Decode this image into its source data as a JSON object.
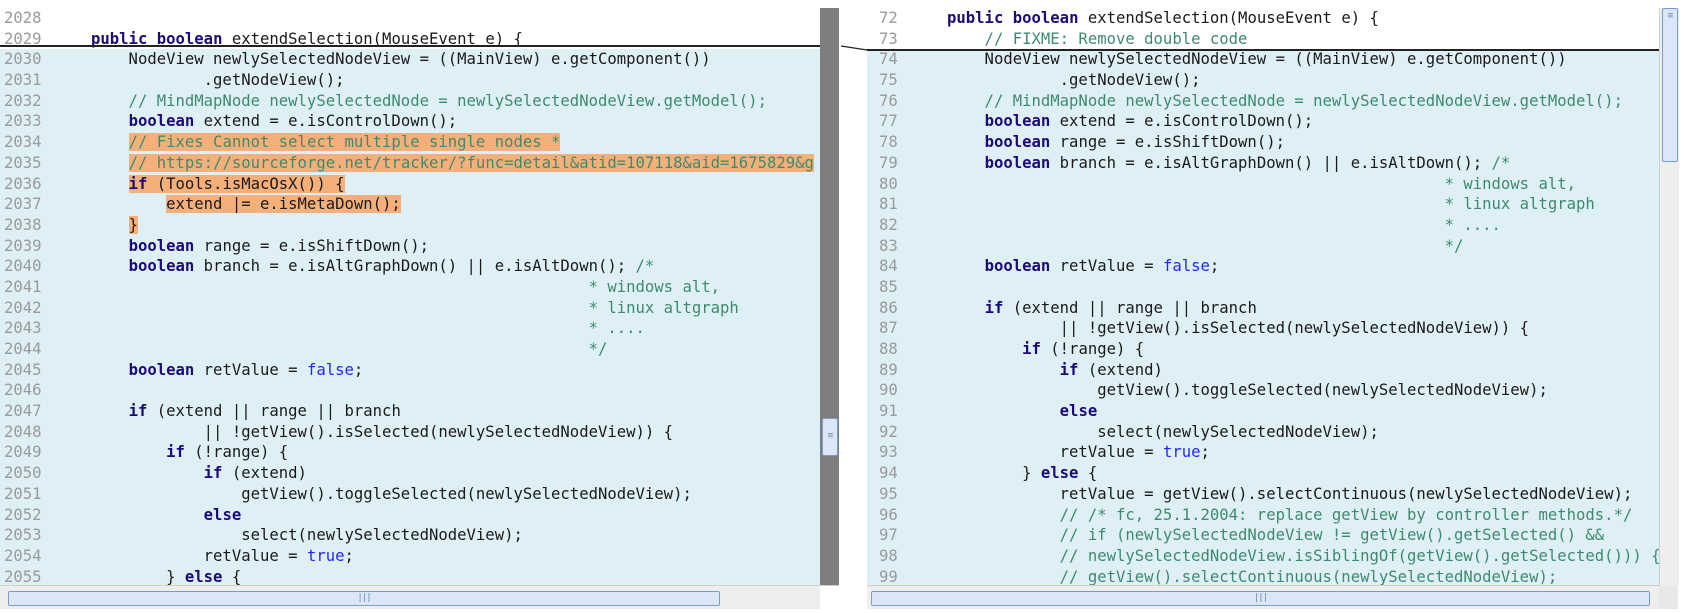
{
  "left": {
    "lines": [
      {
        "n": "2028",
        "code": ""
      },
      {
        "n": "2029",
        "code": "public boolean extendSelection(MouseEvent e) {"
      },
      {
        "n": "2030",
        "code": "    NodeView newlySelectedNodeView = ((MainView) e.getComponent())"
      },
      {
        "n": "2031",
        "code": "            .getNodeView();"
      },
      {
        "n": "2032",
        "code": "    // MindMapNode newlySelectedNode = newlySelectedNodeView.getModel();"
      },
      {
        "n": "2033",
        "code": "    boolean extend = e.isControlDown();"
      },
      {
        "n": "2034",
        "code": "    // Fixes Cannot select multiple single nodes *"
      },
      {
        "n": "2035",
        "code": "    // https://sourceforge.net/tracker/?func=detail&atid=107118&aid=1675829&g"
      },
      {
        "n": "2036",
        "code": "    if (Tools.isMacOsX()) {"
      },
      {
        "n": "2037",
        "code": "        extend |= e.isMetaDown();"
      },
      {
        "n": "2038",
        "code": "    }"
      },
      {
        "n": "2039",
        "code": "    boolean range = e.isShiftDown();"
      },
      {
        "n": "2040",
        "code": "    boolean branch = e.isAltGraphDown() || e.isAltDown(); /*"
      },
      {
        "n": "2041",
        "code": "                                                     * windows alt,"
      },
      {
        "n": "2042",
        "code": "                                                     * linux altgraph"
      },
      {
        "n": "2043",
        "code": "                                                     * ...."
      },
      {
        "n": "2044",
        "code": "                                                     */"
      },
      {
        "n": "2045",
        "code": "    boolean retValue = false;"
      },
      {
        "n": "2046",
        "code": ""
      },
      {
        "n": "2047",
        "code": "    if (extend || range || branch"
      },
      {
        "n": "2048",
        "code": "            || !getView().isSelected(newlySelectedNodeView)) {"
      },
      {
        "n": "2049",
        "code": "        if (!range) {"
      },
      {
        "n": "2050",
        "code": "            if (extend)"
      },
      {
        "n": "2051",
        "code": "                getView().toggleSelected(newlySelectedNodeView);"
      },
      {
        "n": "2052",
        "code": "            else"
      },
      {
        "n": "2053",
        "code": "                select(newlySelectedNodeView);"
      },
      {
        "n": "2054",
        "code": "            retValue = true;"
      },
      {
        "n": "2055",
        "code": "        } else {"
      }
    ]
  },
  "right": {
    "lines": [
      {
        "n": "72",
        "code": "public boolean extendSelection(MouseEvent e) {"
      },
      {
        "n": "73",
        "code": "    // FIXME: Remove double code"
      },
      {
        "n": "74",
        "code": "    NodeView newlySelectedNodeView = ((MainView) e.getComponent())"
      },
      {
        "n": "75",
        "code": "            .getNodeView();"
      },
      {
        "n": "76",
        "code": "    // MindMapNode newlySelectedNode = newlySelectedNodeView.getModel();"
      },
      {
        "n": "77",
        "code": "    boolean extend = e.isControlDown();"
      },
      {
        "n": "78",
        "code": "    boolean range = e.isShiftDown();"
      },
      {
        "n": "79",
        "code": "    boolean branch = e.isAltGraphDown() || e.isAltDown(); /*"
      },
      {
        "n": "80",
        "code": "                                                     * windows alt,"
      },
      {
        "n": "81",
        "code": "                                                     * linux altgraph"
      },
      {
        "n": "82",
        "code": "                                                     * ...."
      },
      {
        "n": "83",
        "code": "                                                     */"
      },
      {
        "n": "84",
        "code": "    boolean retValue = false;"
      },
      {
        "n": "85",
        "code": ""
      },
      {
        "n": "86",
        "code": "    if (extend || range || branch"
      },
      {
        "n": "87",
        "code": "            || !getView().isSelected(newlySelectedNodeView)) {"
      },
      {
        "n": "88",
        "code": "        if (!range) {"
      },
      {
        "n": "89",
        "code": "            if (extend)"
      },
      {
        "n": "90",
        "code": "                getView().toggleSelected(newlySelectedNodeView);"
      },
      {
        "n": "91",
        "code": "            else"
      },
      {
        "n": "92",
        "code": "                select(newlySelectedNodeView);"
      },
      {
        "n": "93",
        "code": "            retValue = true;"
      },
      {
        "n": "94",
        "code": "        } else {"
      },
      {
        "n": "95",
        "code": "            retValue = getView().selectContinuous(newlySelectedNodeView);"
      },
      {
        "n": "96",
        "code": "            // /* fc, 25.1.2004: replace getView by controller methods.*/"
      },
      {
        "n": "97",
        "code": "            // if (newlySelectedNodeView != getView().getSelected() &&"
      },
      {
        "n": "98",
        "code": "            // newlySelectedNodeView.isSiblingOf(getView().getSelected())) {"
      },
      {
        "n": "99",
        "code": "            // getView().selectContinuous(newlySelectedNodeView);"
      }
    ]
  },
  "scrollbars": {
    "vertical_grip_icon": "grip-lines",
    "horizontal_grip_icon": "grip-lines"
  },
  "colors": {
    "changed_block_bg": "#def0f6",
    "inline_change_highlight": "#f5b07a",
    "keyword": "#1c0a78",
    "literal": "#2424ff",
    "comment": "#3f8a6e"
  }
}
